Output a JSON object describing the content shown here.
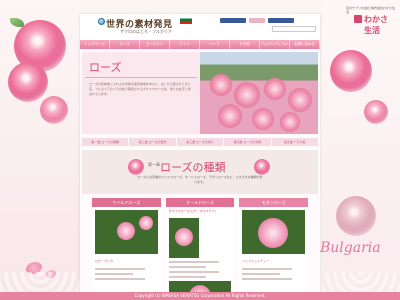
{
  "header": {
    "logo_title": "世界の素材発見",
    "logo_subtitle": "ザクロのはしろ・ブルガリア",
    "search_placeholder": ""
  },
  "nav": {
    "items": [
      "トップページ",
      "ローズ",
      "ヨーグルト",
      "ワイン",
      "ハーブ",
      "その他",
      "ブルガリアについて",
      "お問い合わせ"
    ]
  },
  "hero": {
    "title": "ローズ",
    "body": "ローズの原産地とされる北半球の温帯地域を中心に、古くから愛されてきた花。ブルガリアのバラの谷で栽培されるダマスクローズは、香りの女王と呼ばれています。"
  },
  "tabs": [
    "第一章 ローズの種類",
    "第二章 ローズの歴史",
    "第三章 ローズの香り",
    "第四章 ローズの効能",
    "第五章 バラの谷"
  ],
  "section": {
    "number": "第一章",
    "title": "ローズの種類",
    "body": "ローズには原種のワイルドローズ、オールドローズ、モダンローズなど、さまざまな種類があります。"
  },
  "columns": [
    {
      "title": "ワイルドローズ",
      "caption": "ロサ・ガリカ"
    },
    {
      "title": "オールドローズ",
      "caption": "ダマスクローズ(ロサ・ダマスケナ)"
    },
    {
      "title": "モダンローズ",
      "caption": "ハイブリッドティー"
    }
  ],
  "brand": {
    "name": "わかさ生活",
    "tagline": "目のサプリの会社 株式会社わかさ生活"
  },
  "script_text": "Bulgaria",
  "footer": {
    "copyright": "Copyright (c) WAKASA SEIKATSU Corporation All Rights Reserved."
  }
}
